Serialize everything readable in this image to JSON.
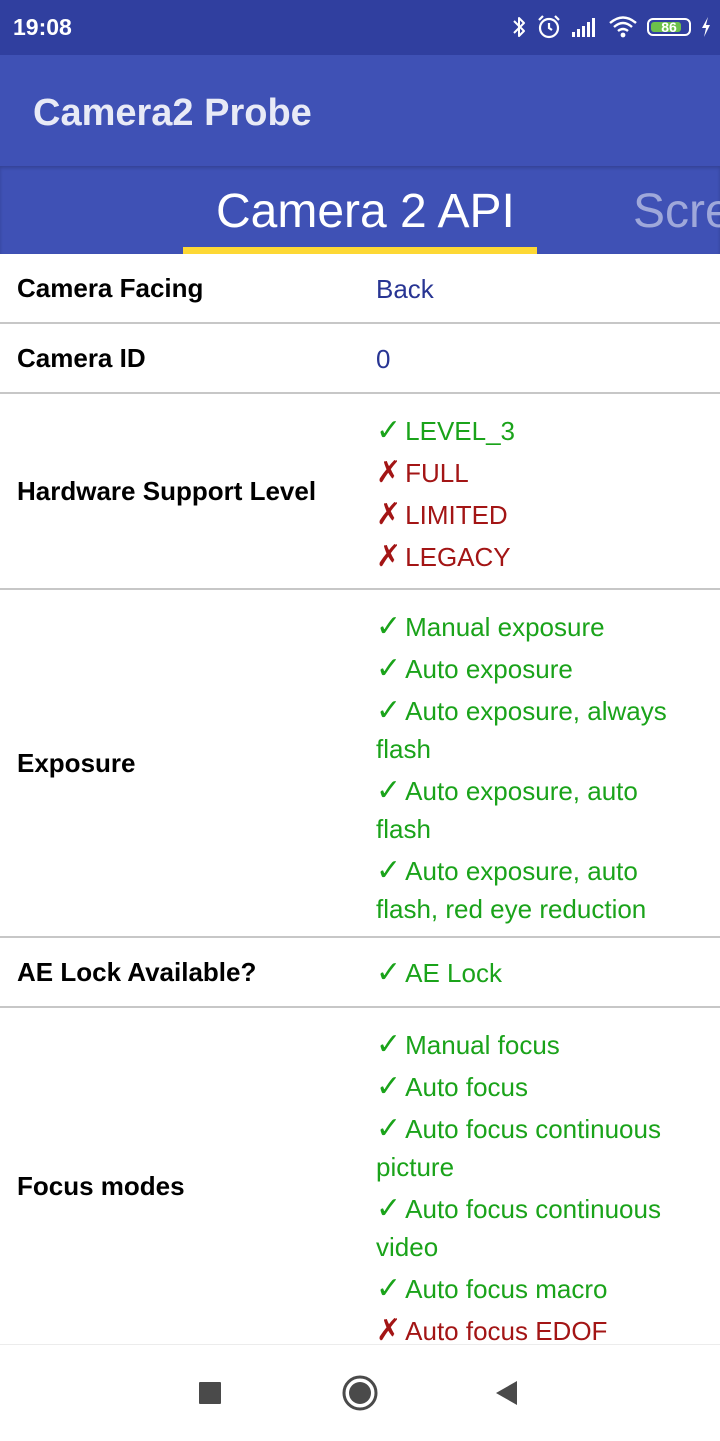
{
  "status_bar": {
    "time": "19:08",
    "battery_level": "86",
    "icons": [
      "bluetooth-icon",
      "alarm-icon",
      "signal-icon",
      "wifi-icon",
      "battery-icon",
      "charging-icon"
    ]
  },
  "app_bar": {
    "title": "Camera2 Probe"
  },
  "tabs": [
    {
      "label": "Camera 2 API",
      "active": true
    },
    {
      "label": "Scre",
      "active": false
    }
  ],
  "rows": {
    "camera_facing": {
      "label": "Camera Facing",
      "value": "Back"
    },
    "camera_id": {
      "label": "Camera ID",
      "value": "0"
    },
    "hardware_support": {
      "label": "Hardware Support Level",
      "items": [
        {
          "mark": "✓",
          "text": "LEVEL_3",
          "supported": true
        },
        {
          "mark": "✗",
          "text": "FULL",
          "supported": false
        },
        {
          "mark": "✗",
          "text": "LIMITED",
          "supported": false
        },
        {
          "mark": "✗",
          "text": "LEGACY",
          "supported": false
        }
      ]
    },
    "exposure": {
      "label": "Exposure",
      "items": [
        {
          "mark": "✓",
          "text": "Manual exposure",
          "supported": true
        },
        {
          "mark": "✓",
          "text": "Auto exposure",
          "supported": true
        },
        {
          "mark": "✓",
          "text": "Auto exposure, always flash",
          "supported": true
        },
        {
          "mark": "✓",
          "text": "Auto exposure, auto flash",
          "supported": true
        },
        {
          "mark": "✓",
          "text": "Auto exposure, auto flash, red eye reduction",
          "supported": true
        }
      ]
    },
    "ae_lock": {
      "label": "AE Lock Available?",
      "items": [
        {
          "mark": "✓",
          "text": "AE Lock",
          "supported": true
        }
      ]
    },
    "focus_modes": {
      "label": "Focus modes",
      "items": [
        {
          "mark": "✓",
          "text": "Manual focus",
          "supported": true
        },
        {
          "mark": "✓",
          "text": "Auto focus",
          "supported": true
        },
        {
          "mark": "✓",
          "text": "Auto focus continuous picture",
          "supported": true
        },
        {
          "mark": "✓",
          "text": "Auto focus continuous video",
          "supported": true
        },
        {
          "mark": "✓",
          "text": "Auto focus macro",
          "supported": true
        },
        {
          "mark": "✗",
          "text": "Auto focus EDOF",
          "supported": false
        }
      ]
    }
  },
  "nav_bar": {
    "buttons": [
      "recents-icon",
      "home-icon",
      "back-icon"
    ]
  },
  "colors": {
    "status_bar": "#303f9f",
    "primary": "#3f51b5",
    "tab_indicator": "#fdd835",
    "supported": "#1aa31a",
    "unsupported": "#a31515",
    "value_text": "#283593"
  }
}
